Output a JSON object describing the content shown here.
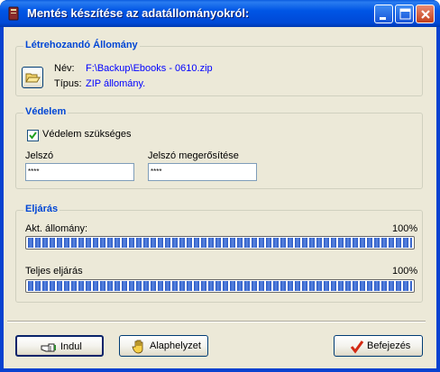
{
  "window": {
    "title": "Mentés készítése az adatállományokról:"
  },
  "file_group": {
    "heading": "Létrehozandó Állomány",
    "name_label": "Név:",
    "name_value": "F:\\Backup\\Ebooks - 0610.zip",
    "type_label": "Típus:",
    "type_value": "ZIP állomány."
  },
  "protection_group": {
    "heading": "Védelem",
    "checkbox_label": "Védelem szükséges",
    "checkbox_checked": true,
    "password_label": "Jelszó",
    "password_value": "****",
    "confirm_label": "Jelszó megerősítése",
    "confirm_value": "****"
  },
  "process_group": {
    "heading": "Eljárás",
    "current_label": "Akt. állomány:",
    "current_percent_text": "100%",
    "current_progress": 1.0,
    "total_label": "Teljes eljárás",
    "total_percent_text": "100%",
    "total_progress": 1.0
  },
  "buttons": {
    "start": "Indul",
    "reset": "Alaphelyzet",
    "finish": "Befejezés"
  },
  "colors": {
    "titlebar": "#0055e5",
    "group_heading": "#0046d5",
    "value_text": "#0000ff",
    "progress_block": "#2a58c4",
    "finish_check": "#d32a14"
  }
}
